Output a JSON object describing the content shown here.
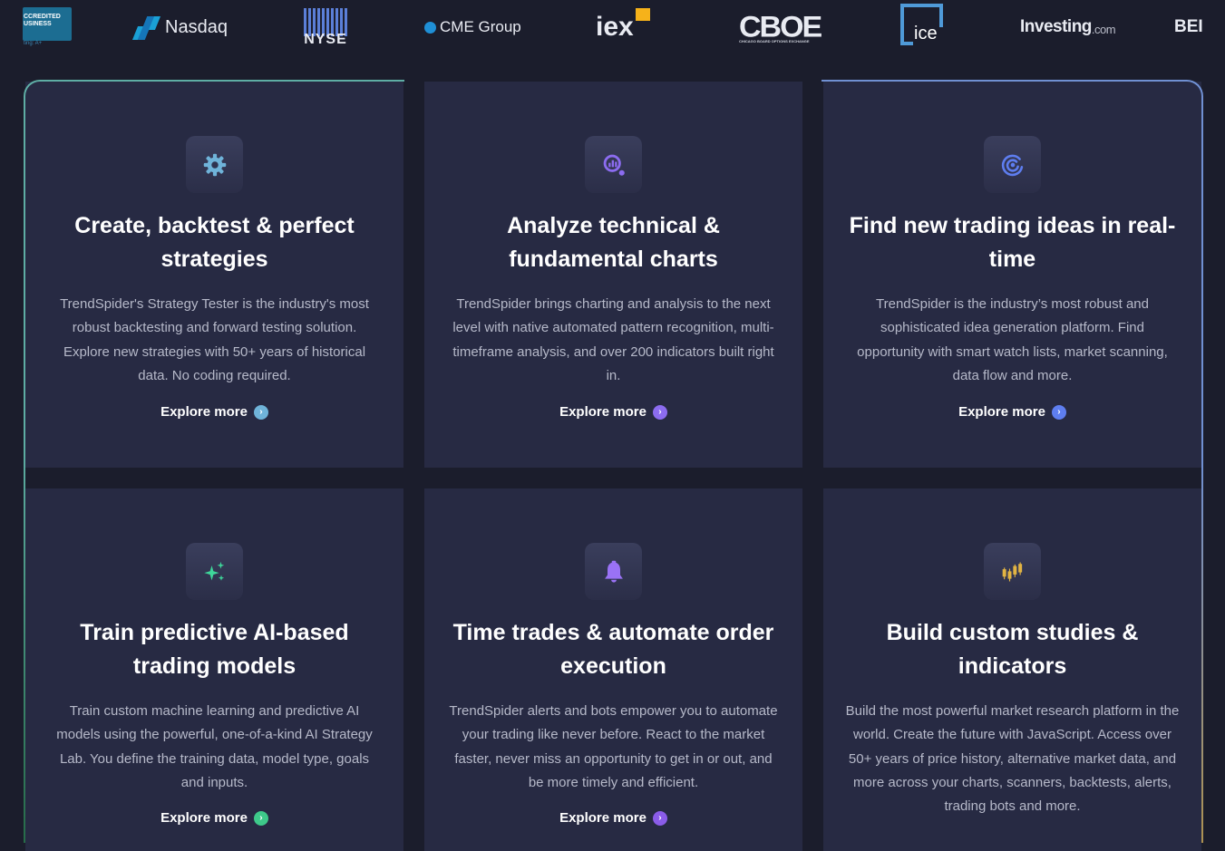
{
  "partners": {
    "bbb": {
      "line1": "CCREDITED",
      "line2": "USINESS",
      "rating": "ting: A+"
    },
    "nasdaq": "Nasdaq",
    "nyse": "NYSE",
    "cme": "CME Group",
    "iex": "iex",
    "cboe": "CBOE",
    "cboe_sub": "CHICAGO BOARD OPTIONS EXCHANGE",
    "ice": "ice",
    "investing": "Investing",
    "investing_suffix": ".com",
    "cut": "BEI"
  },
  "colors": {
    "page_bg": "#1b1d2c",
    "card_bg": "#272a43",
    "accent_teal": "#6fd2c2",
    "accent_blue": "#7fa5f0"
  },
  "features": [
    {
      "icon": "gear-icon",
      "icon_color": "#6fb3d9",
      "title": "Create, backtest & perfect strategies",
      "description": "TrendSpider's Strategy Tester is the industry's most robust backtesting and forward testing solution. Explore new strategies with 50+ years of historical data. No coding required.",
      "link": "Explore more",
      "link_dot": "#6fb3d9"
    },
    {
      "icon": "chart-search-icon",
      "icon_color": "#8c6cf0",
      "title": "Analyze technical & fundamental charts",
      "description": "TrendSpider brings charting and analysis to the next level with native automated pattern recognition, multi-timeframe analysis, and over 200 indicators built right in.",
      "link": "Explore more",
      "link_dot": "#8c6cf0"
    },
    {
      "icon": "radar-icon",
      "icon_color": "#5e7ef0",
      "title": "Find new trading ideas in real-time",
      "description": "TrendSpider is the industry’s most robust and sophisticated idea generation platform. Find opportunity with smart watch lists, market scanning, data flow and more.",
      "link": "Explore more",
      "link_dot": "#5e7ef0"
    },
    {
      "icon": "sparkles-icon",
      "icon_color": "#3ed69a",
      "title": "Train predictive AI-based trading models",
      "description": "Train custom machine learning and predictive AI models using the powerful, one-of-a-kind AI Strategy Lab. You define the training data, model type, goals and inputs.",
      "link": "Explore more",
      "link_dot": "#3ec98a"
    },
    {
      "icon": "bell-icon",
      "icon_color": "#9a72f5",
      "title": "Time trades & automate order execution",
      "description": "TrendSpider alerts and bots empower you to automate your trading like never before. React to the market faster, never miss an opportunity to get in or out, and be more timely and efficient.",
      "link": "Explore more",
      "link_dot": "#8a5ce8"
    },
    {
      "icon": "candlestick-icon",
      "icon_color": "#e2b443",
      "title": "Build custom studies & indicators",
      "description": "Build the most powerful market research platform in the world. Create the future with JavaScript. Access over 50+ years of price history, alternative market data, and more across your charts, scanners, backtests, alerts, trading bots and more.",
      "link": "Explore more",
      "link_dot": "#e2b443"
    }
  ]
}
